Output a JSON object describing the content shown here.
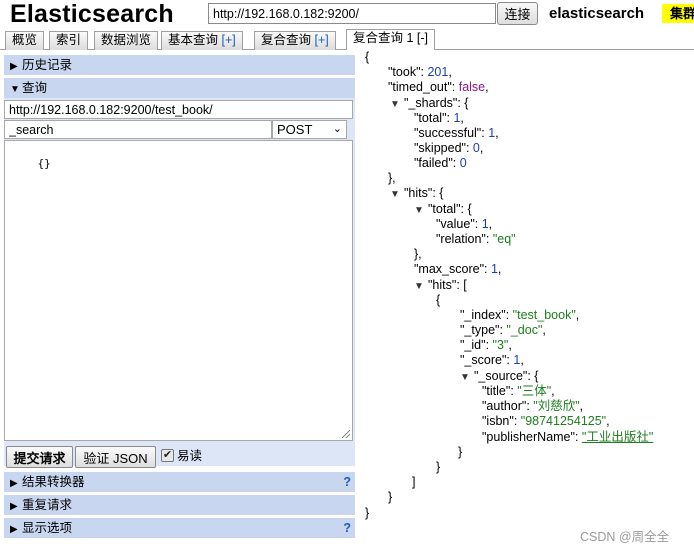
{
  "header": {
    "app_title": "Elasticsearch",
    "url_value": "http://192.168.0.182:9200/",
    "connect_label": "连接",
    "cluster_name": "elasticsearch",
    "cluster_status": "集群",
    "status_color": "#ffff00"
  },
  "tabs": [
    {
      "label": "概览"
    },
    {
      "label": "索引"
    },
    {
      "label": "数据浏览"
    },
    {
      "label": "基本查询",
      "extra": "[+]"
    },
    {
      "label": "复合查询",
      "extra": "[+]"
    },
    {
      "label": "复合查询 1",
      "extra": "[-]",
      "active": true
    }
  ],
  "left": {
    "history_label": "历史记录",
    "query_label": "查询",
    "path_value": "http://192.168.0.182:9200/test_book/",
    "endpoint_value": "_search",
    "method_value": "POST",
    "body_value": "{}",
    "submit_label": "提交请求",
    "validate_label": "验证 JSON",
    "readonly_label": "易读",
    "readonly_checked": "✔",
    "transformer_label": "结果转换器",
    "repeat_label": "重复请求",
    "display_label": "显示选项",
    "help_glyph": "?"
  },
  "result": {
    "open_brace": "{",
    "took_key": "\"took\"",
    "took_value": "201",
    "timed_out_key": "\"timed_out\"",
    "timed_out_value": "false",
    "shards_key": "\"_shards\"",
    "shards_total_key": "\"total\"",
    "shards_total_value": "1",
    "shards_successful_key": "\"successful\"",
    "shards_successful_value": "1",
    "shards_skipped_key": "\"skipped\"",
    "shards_skipped_value": "0",
    "shards_failed_key": "\"failed\"",
    "shards_failed_value": "0",
    "hits_key": "\"hits\"",
    "hits_total_key": "\"total\"",
    "hits_total_value_key": "\"value\"",
    "hits_total_value": "1",
    "hits_relation_key": "\"relation\"",
    "hits_relation_value": "\"eq\"",
    "max_score_key": "\"max_score\"",
    "max_score_value": "1",
    "hits_array_key": "\"hits\"",
    "doc_index_key": "\"_index\"",
    "doc_index_value": "\"test_book\"",
    "doc_type_key": "\"_type\"",
    "doc_type_value": "\"_doc\"",
    "doc_id_key": "\"_id\"",
    "doc_id_value": "\"3\"",
    "doc_score_key": "\"_score\"",
    "doc_score_value": "1",
    "source_key": "\"_source\"",
    "title_key": "\"title\"",
    "title_value": "\"三体\"",
    "author_key": "\"author\"",
    "author_value": "\"刘慈欣\"",
    "isbn_key": "\"isbn\"",
    "isbn_value": "\"98741254125\"",
    "publisher_key": "\"publisherName\"",
    "publisher_value": "\"工业出版社\""
  },
  "watermark": "CSDN @周全全"
}
